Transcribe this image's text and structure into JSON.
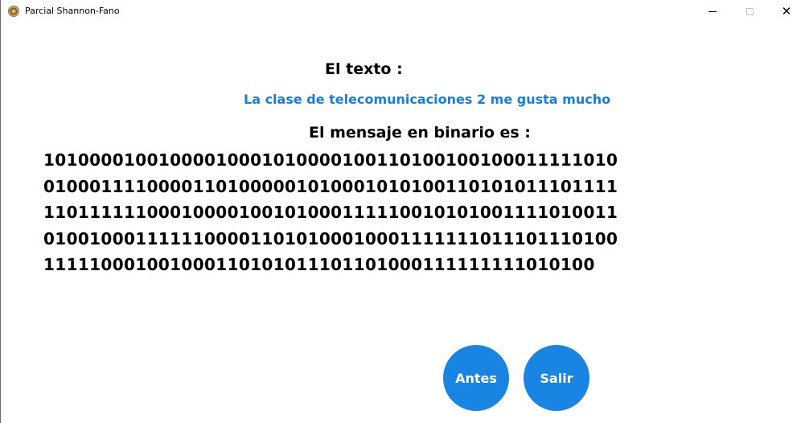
{
  "window": {
    "title": "Parcial Shannon-Fano",
    "icon": "app-medallion-icon",
    "controls": {
      "minimize_icon": "minimize-icon",
      "maximize_icon": "maximize-icon",
      "close_glyph": "✕"
    }
  },
  "main": {
    "text_heading": "El texto :",
    "input_text": "La clase de telecomunicaciones 2 me gusta mucho",
    "binary_heading": "El mensaje en binario es :",
    "binary_lines": [
      "1010000100100001000101000010011010010010001111101 0",
      "01000111100001101000001010001010100110101011101111",
      "11011111100010000100101000111110010101001111010011",
      "01001000111111000011010100010001111111011101110100",
      "111110001001000110101011101101000111111111010100"
    ]
  },
  "buttons": {
    "antes_label": "Antes",
    "salir_label": "Salir"
  },
  "colors": {
    "accent": "#1a84e3",
    "input_text": "#1a7ed6",
    "background": "#ffffff",
    "heading": "#000000"
  }
}
